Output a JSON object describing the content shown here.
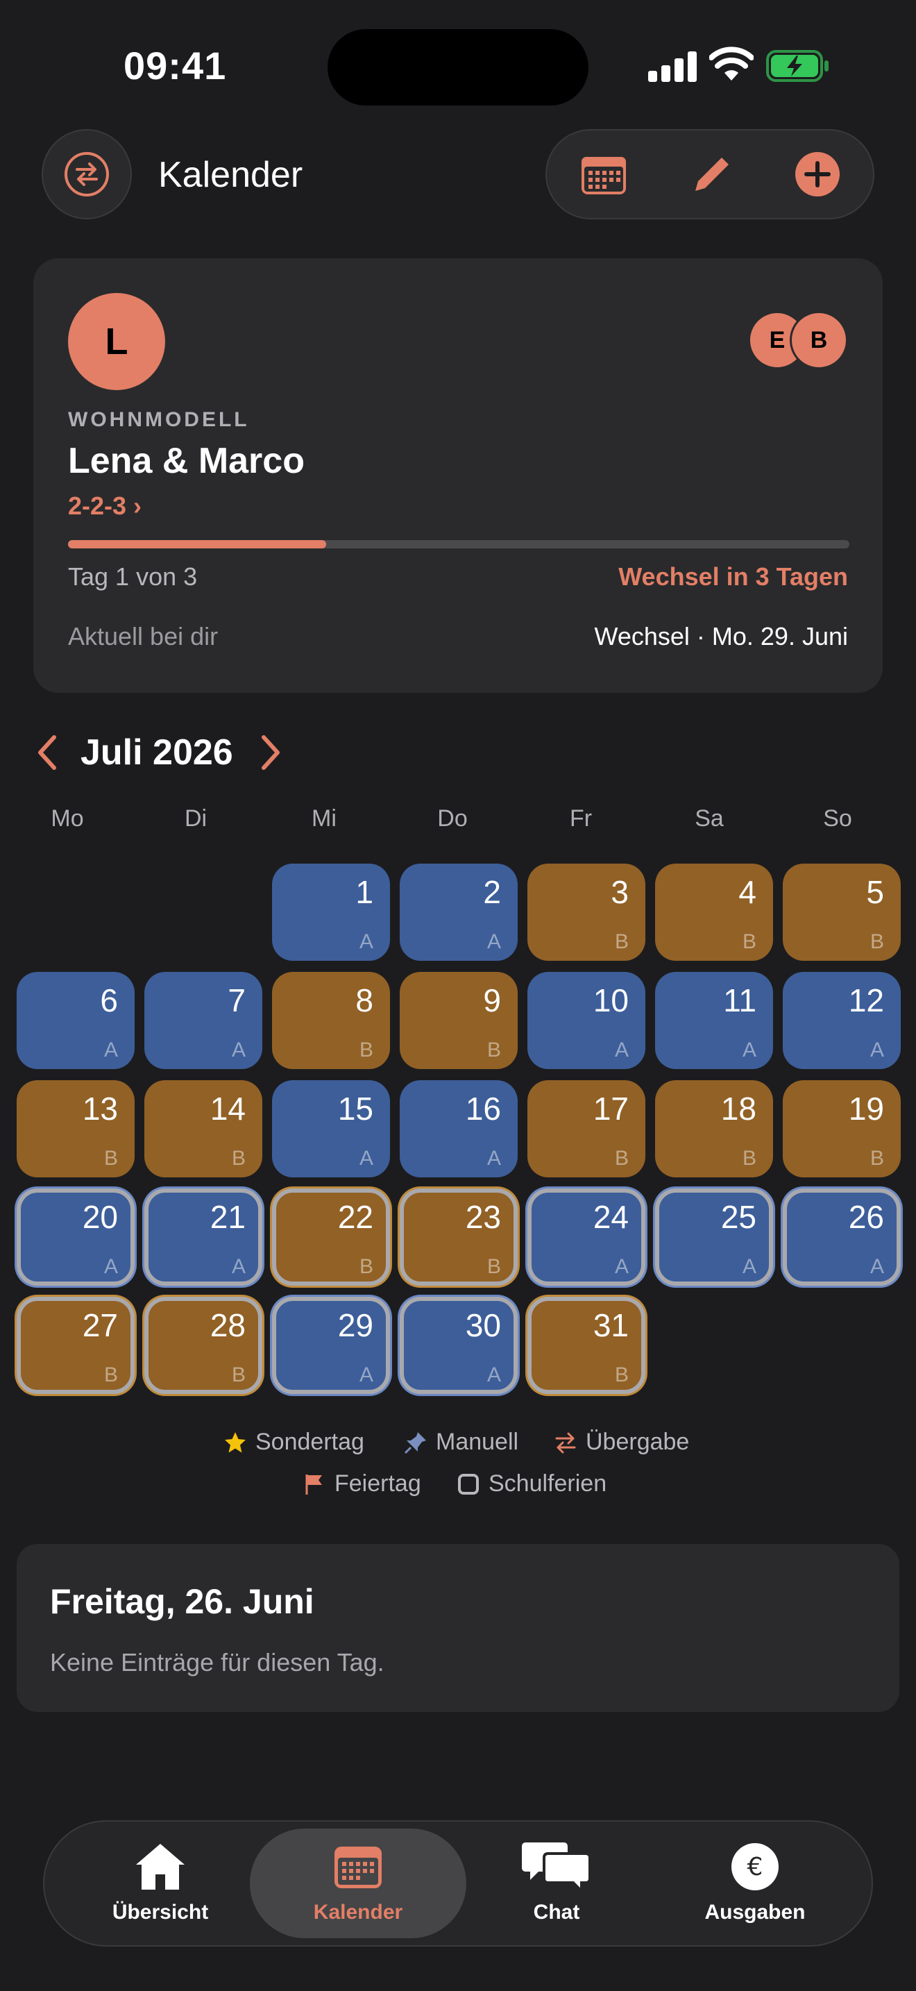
{
  "status_bar": {
    "time": "09:41"
  },
  "header": {
    "title": "Kalender"
  },
  "card": {
    "avatar_initial": "L",
    "members": [
      "E",
      "B"
    ],
    "section_label": "WOHNMODELL",
    "family_name": "Lena & Marco",
    "pattern": "2-2-3 ›",
    "progress": 0.33,
    "day_of": "Tag 1 von 3",
    "switch_in": "Wechsel in 3 Tagen",
    "current_location": "Aktuell bei dir",
    "switch_date": "Wechsel · Mo. 29. Juni"
  },
  "calendar": {
    "month_title": "Juli 2026",
    "weekdays": [
      "Mo",
      "Di",
      "Mi",
      "Do",
      "Fr",
      "Sa",
      "So"
    ],
    "first_weekday_index": 2,
    "days": [
      {
        "day": "1",
        "parent": "A"
      },
      {
        "day": "2",
        "parent": "A"
      },
      {
        "day": "3",
        "parent": "B"
      },
      {
        "day": "4",
        "parent": "B"
      },
      {
        "day": "5",
        "parent": "B"
      },
      {
        "day": "6",
        "parent": "A"
      },
      {
        "day": "7",
        "parent": "A"
      },
      {
        "day": "8",
        "parent": "B"
      },
      {
        "day": "9",
        "parent": "B"
      },
      {
        "day": "10",
        "parent": "A"
      },
      {
        "day": "11",
        "parent": "A"
      },
      {
        "day": "12",
        "parent": "A"
      },
      {
        "day": "13",
        "parent": "B"
      },
      {
        "day": "14",
        "parent": "B"
      },
      {
        "day": "15",
        "parent": "A"
      },
      {
        "day": "16",
        "parent": "A"
      },
      {
        "day": "17",
        "parent": "B"
      },
      {
        "day": "18",
        "parent": "B"
      },
      {
        "day": "19",
        "parent": "B"
      },
      {
        "day": "20",
        "parent": "A",
        "vacation": true
      },
      {
        "day": "21",
        "parent": "A",
        "vacation": true
      },
      {
        "day": "22",
        "parent": "B",
        "vacation": true
      },
      {
        "day": "23",
        "parent": "B",
        "vacation": true
      },
      {
        "day": "24",
        "parent": "A",
        "vacation": true
      },
      {
        "day": "25",
        "parent": "A",
        "vacation": true
      },
      {
        "day": "26",
        "parent": "A",
        "vacation": true
      },
      {
        "day": "27",
        "parent": "B",
        "vacation": true
      },
      {
        "day": "28",
        "parent": "B",
        "vacation": true
      },
      {
        "day": "29",
        "parent": "A",
        "vacation": true
      },
      {
        "day": "30",
        "parent": "A",
        "vacation": true
      },
      {
        "day": "31",
        "parent": "B",
        "vacation": true
      }
    ],
    "colors": {
      "A": "#3d5e99",
      "B": "#926126",
      "accent": "#e37f66"
    }
  },
  "legend": {
    "special": "Sondertag",
    "manual": "Manuell",
    "handover": "Übergabe",
    "holiday": "Feiertag",
    "school_holidays": "Schulferien"
  },
  "day_detail": {
    "title": "Freitag, 26. Juni",
    "empty_text": "Keine Einträge für diesen Tag."
  },
  "tabbar": {
    "tabs": [
      {
        "label": "Übersicht",
        "icon": "house-icon"
      },
      {
        "label": "Kalender",
        "icon": "calendar-icon",
        "active": true
      },
      {
        "label": "Chat",
        "icon": "chat-icon"
      },
      {
        "label": "Ausgaben",
        "icon": "euro-icon"
      }
    ]
  }
}
